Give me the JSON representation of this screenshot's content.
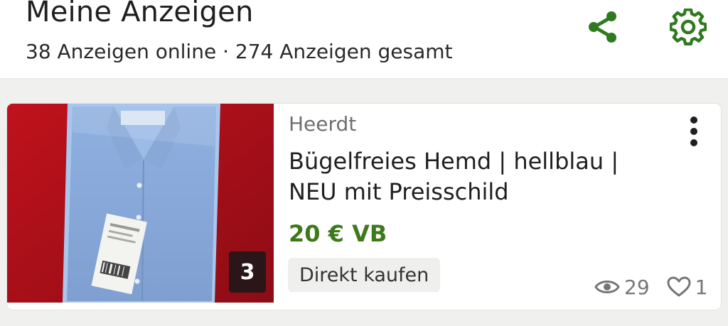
{
  "header": {
    "title": "Meine Anzeigen",
    "subtitle": "38 Anzeigen online · 274 Anzeigen gesamt",
    "share_icon": "share-icon",
    "settings_icon": "gear-icon"
  },
  "listing": {
    "image_count": "3",
    "location": "Heerdt",
    "title": "Bügelfreies Hemd | hellblau | NEU mit Preisschild",
    "price": "20 € VB",
    "direct_buy_label": "Direkt kaufen",
    "views": "29",
    "favorites": "1",
    "menu_icon": "more-vertical-icon"
  },
  "colors": {
    "accent_green": "#3e7a1b",
    "icon_green": "#2f7a1f",
    "stat_gray": "#767676"
  }
}
